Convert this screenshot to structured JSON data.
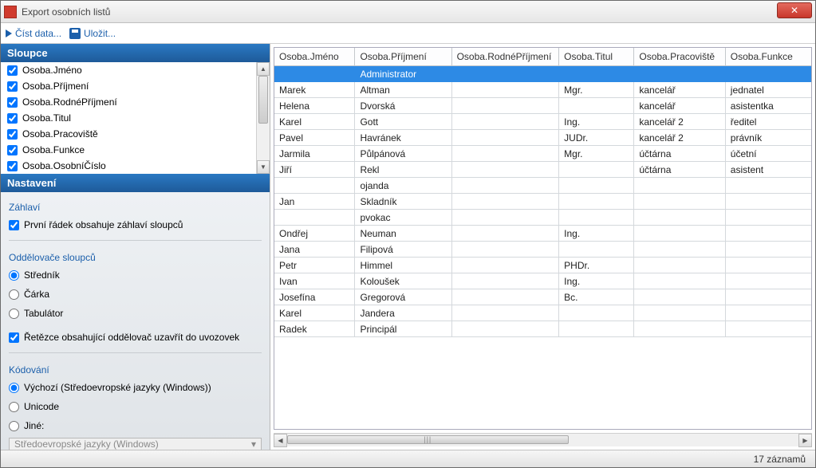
{
  "window": {
    "title": "Export osobních listů"
  },
  "toolbar": {
    "read_label": "Číst data...",
    "save_label": "Uložit..."
  },
  "panels": {
    "columns_header": "Sloupce",
    "settings_header": "Nastavení"
  },
  "columns": [
    {
      "label": "Osoba.Jméno",
      "checked": true
    },
    {
      "label": "Osoba.Příjmení",
      "checked": true
    },
    {
      "label": "Osoba.RodnéPříjmení",
      "checked": true
    },
    {
      "label": "Osoba.Titul",
      "checked": true
    },
    {
      "label": "Osoba.Pracoviště",
      "checked": true
    },
    {
      "label": "Osoba.Funkce",
      "checked": true
    },
    {
      "label": "Osoba.OsobníČíslo",
      "checked": true
    }
  ],
  "settings": {
    "header_label": "Záhlaví",
    "first_row_header": "První řádek obsahuje záhlaví sloupců",
    "delimiters_label": "Oddělovače sloupců",
    "semicolon": "Středník",
    "comma": "Čárka",
    "tab": "Tabulátor",
    "quote_strings": "Řetězce obsahující oddělovač uzavřít do uvozovek",
    "encoding_label": "Kódování",
    "encoding_default": "Výchozí (Středoevropské jazyky (Windows))",
    "encoding_unicode": "Unicode",
    "encoding_other": "Jiné:",
    "encoding_combo": "Středoevropské jazyky (Windows)"
  },
  "table": {
    "headers": [
      "Osoba.Jméno",
      "Osoba.Příjmení",
      "Osoba.RodnéPříjmení",
      "Osoba.Titul",
      "Osoba.Pracoviště",
      "Osoba.Funkce"
    ],
    "rows": [
      [
        "",
        "Administrator",
        "",
        "",
        "",
        ""
      ],
      [
        "Marek",
        "Altman",
        "",
        "Mgr.",
        "kancelář",
        "jednatel"
      ],
      [
        "Helena",
        "Dvorská",
        "",
        "",
        "kancelář",
        "asistentka"
      ],
      [
        "Karel",
        "Gott",
        "",
        "Ing.",
        "kancelář 2",
        "ředitel"
      ],
      [
        "Pavel",
        "Havránek",
        "",
        "JUDr.",
        "kancelář 2",
        "právník"
      ],
      [
        "Jarmila",
        "Půlpánová",
        "",
        "Mgr.",
        "účtárna",
        "účetní"
      ],
      [
        "Jiří",
        "Rekl",
        "",
        "",
        "účtárna",
        "asistent"
      ],
      [
        "",
        "ojanda",
        "",
        "",
        "",
        ""
      ],
      [
        "Jan",
        "Skladník",
        "",
        "",
        "",
        ""
      ],
      [
        "",
        "pvokac",
        "",
        "",
        "",
        ""
      ],
      [
        "Ondřej",
        "Neuman",
        "",
        "Ing.",
        "",
        ""
      ],
      [
        "Jana",
        "Filipová",
        "",
        "",
        "",
        ""
      ],
      [
        "Petr",
        "Himmel",
        "",
        "PHDr.",
        "",
        ""
      ],
      [
        "Ivan",
        "Koloušek",
        "",
        "Ing.",
        "",
        ""
      ],
      [
        "Josefína",
        "Gregorová",
        "",
        "Bc.",
        "",
        ""
      ],
      [
        "Karel",
        "Jandera",
        "",
        "",
        "",
        ""
      ],
      [
        "Radek",
        "Principál",
        "",
        "",
        "",
        ""
      ]
    ],
    "selected_index": 0
  },
  "status": {
    "count_text": "17 záznamů"
  }
}
